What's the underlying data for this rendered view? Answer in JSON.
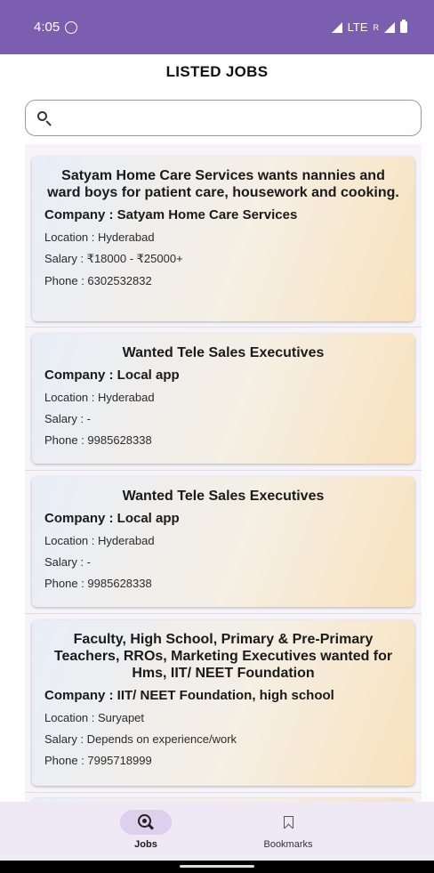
{
  "status_bar": {
    "time": "4:05",
    "network": "LTE",
    "roaming_indicator": "R",
    "icons": [
      "whatsapp-icon",
      "signal-icon",
      "battery-icon"
    ]
  },
  "header": {
    "title": "LISTED JOBS"
  },
  "search": {
    "placeholder": "",
    "value": ""
  },
  "jobs": [
    {
      "title": "Satyam Home Care Services wants nannies and ward boys for patient care, housework and cooking.",
      "company": "Company : Satyam Home Care Services",
      "location": "Location : Hyderabad",
      "salary": "Salary : ₹18000 - ₹25000+",
      "phone": "Phone : 6302532832"
    },
    {
      "title": "Wanted Tele Sales Executives",
      "company": "Company : Local app",
      "location": "Location : Hyderabad",
      "salary": "Salary : -",
      "phone": "Phone : 9985628338"
    },
    {
      "title": "Wanted Tele Sales Executives",
      "company": "Company : Local app",
      "location": "Location : Hyderabad",
      "salary": "Salary : -",
      "phone": "Phone : 9985628338"
    },
    {
      "title": "Faculty, High School, Primary & Pre-Primary Teachers, RROs, Marketing Executives wanted for Hms, IIT/ NEET Foundation",
      "company": "Company : IIT/ NEET Foundation, high school",
      "location": "Location : Suryapet",
      "salary": "Salary : Depends on experience/work",
      "phone": "Phone : 7995718999"
    }
  ],
  "bottom_nav": {
    "items": [
      {
        "label": "Jobs",
        "icon": "jobs-search-icon",
        "active": true
      },
      {
        "label": "Bookmarks",
        "icon": "bookmark-icon",
        "active": false
      }
    ]
  },
  "colors": {
    "status_bar": "#7b5eb0",
    "nav_background": "#efe8f5",
    "active_pill": "#dcd0ec"
  }
}
